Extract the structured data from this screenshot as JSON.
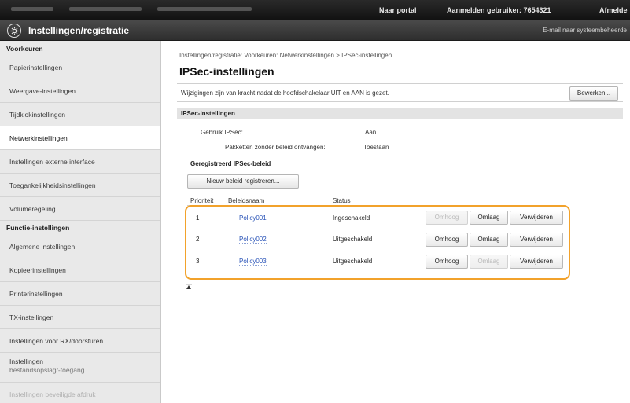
{
  "topbar": {
    "portal": "Naar portal",
    "user": "Aanmelden gebruiker:  7654321",
    "logout": "Afmelde"
  },
  "header": {
    "title": "Instellingen/registratie",
    "mail": "E-mail naar systeembeheerde",
    "logo_icon": "settings-gear-icon"
  },
  "sidebar": {
    "section1": "Voorkeuren",
    "items1": [
      "Papierinstellingen",
      "Weergave-instellingen",
      "Tijdklokinstellingen",
      "Netwerkinstellingen",
      "Instellingen externe interface",
      "Toegankelijkheidsinstellingen",
      "Volumeregeling"
    ],
    "section2": "Functie-instellingen",
    "items2": [
      "Algemene instellingen",
      "Kopieerinstellingen",
      "Printerinstellingen",
      "TX-instellingen",
      "Instellingen voor RX/doorsturen"
    ],
    "item_multiline_1": "Instellingen",
    "item_multiline_2": "bestandsopslag/-toegang",
    "item_faded": "Instellingen beveiligde afdruk"
  },
  "main": {
    "breadcrumb": "Instellingen/registratie: Voorkeuren: Netwerkinstellingen > IPSec-instellingen",
    "title": "IPSec-instellingen",
    "info": "Wijzigingen zijn van kracht nadat de hoofdschakelaar UIT en AAN is gezet.",
    "edit_button": "Bewerken...",
    "group_title": "IPSec-instellingen",
    "use_label": "Gebruik IPSec:",
    "use_value": "Aan",
    "packets_label": "Pakketten zonder beleid ontvangen:",
    "packets_value": "Toestaan",
    "registered_title": "Geregistreerd IPSec-beleid",
    "register_button": "Nieuw beleid registreren...",
    "columns": [
      "Prioriteit",
      "Beleidsnaam",
      "Status"
    ],
    "policies": [
      {
        "priority": "1",
        "name": "Policy001",
        "status": "Ingeschakeld",
        "up": "Omhoog",
        "down": "Omlaag",
        "delete": "Verwijderen",
        "up_enabled": false,
        "down_enabled": true
      },
      {
        "priority": "2",
        "name": "Policy002",
        "status": "Uitgeschakeld",
        "up": "Omhoog",
        "down": "Omlaag",
        "delete": "Verwijderen",
        "up_enabled": true,
        "down_enabled": true
      },
      {
        "priority": "3",
        "name": "Policy003",
        "status": "Uitgeschakeld",
        "up": "Omhoog",
        "down": "Omlaag",
        "delete": "Verwijderen",
        "up_enabled": true,
        "down_enabled": false
      }
    ],
    "highlight_color": "#f2a22b",
    "link_color": "#2a54b8",
    "to_top_icon": "arrow-to-top-icon"
  }
}
